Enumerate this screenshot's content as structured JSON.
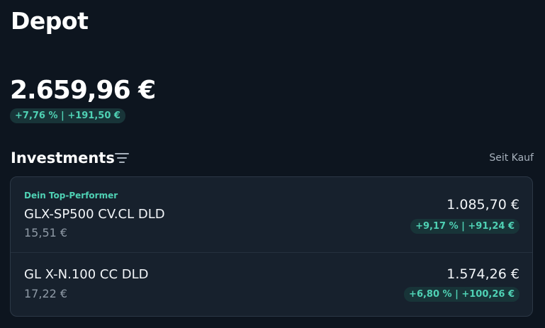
{
  "header": {
    "title": "Depot"
  },
  "portfolio": {
    "total_value": "2.659,96 €",
    "change": "+7,76 % | +191,50 €"
  },
  "investments": {
    "title": "Investments",
    "sort_label": "Seit Kauf",
    "items": [
      {
        "badge": "Dein Top-Performer",
        "name": "GLX-SP500 CV.CL DLD",
        "price": "15,51 €",
        "value": "1.085,70 €",
        "change": "+9,17 % | +91,24 €"
      },
      {
        "name": "GL X-N.100 CC DLD",
        "price": "17,22 €",
        "value": "1.574,26 €",
        "change": "+6,80 % | +100,26 €"
      }
    ]
  },
  "colors": {
    "background": "#0d151f",
    "card": "#17212d",
    "accent_green": "#4fd1b4",
    "pill_background": "#183438"
  },
  "icons": {
    "filter": "filter-lines-icon"
  }
}
